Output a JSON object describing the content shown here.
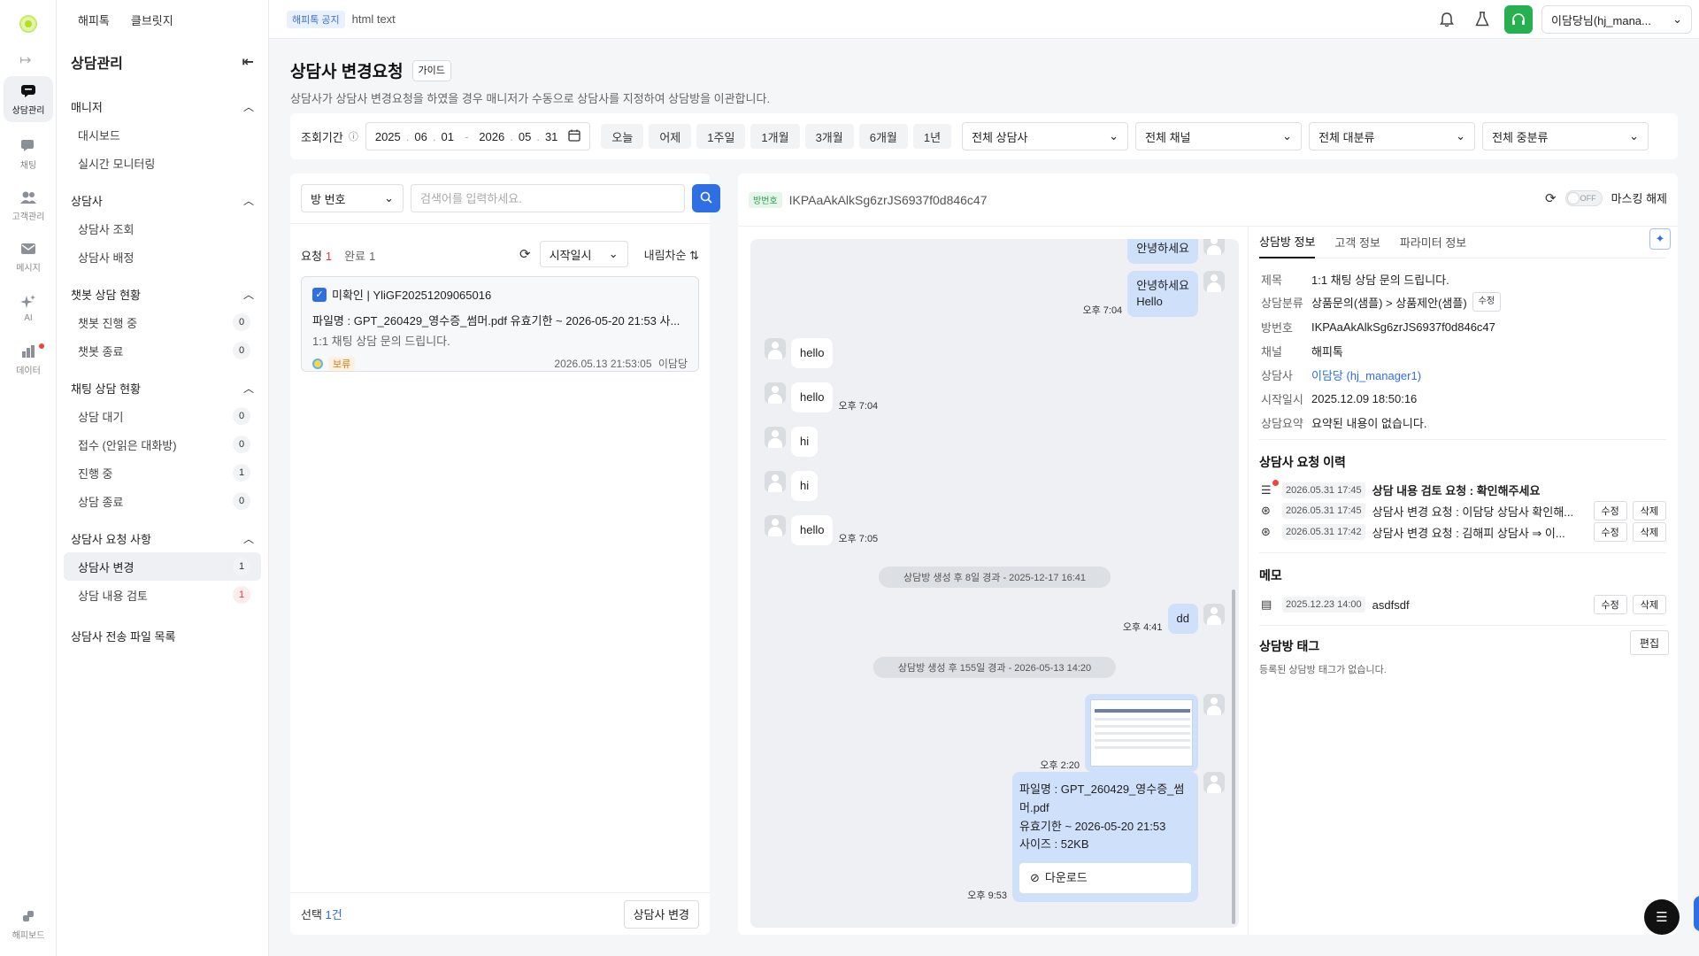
{
  "rail": {
    "items": [
      {
        "label": "상담관리",
        "icon": "chat-bubble-icon"
      },
      {
        "label": "채팅",
        "icon": "message-icon"
      },
      {
        "label": "고객관리",
        "icon": "users-icon"
      },
      {
        "label": "메시지",
        "icon": "mail-icon"
      },
      {
        "label": "AI",
        "icon": "sparkle-icon"
      },
      {
        "label": "데이터",
        "icon": "bar-chart-icon"
      }
    ],
    "bottom_label": "해피보드"
  },
  "sidebar": {
    "top_links": [
      "해피톡",
      "클브릿지"
    ],
    "title": "상담관리",
    "groups": [
      {
        "label": "매니저",
        "items": [
          {
            "label": "대시보드"
          },
          {
            "label": "실시간 모니터링"
          }
        ]
      },
      {
        "label": "상담사",
        "items": [
          {
            "label": "상담사 조회"
          },
          {
            "label": "상담사 배정"
          }
        ]
      },
      {
        "label": "챗봇 상담 현황",
        "items": [
          {
            "label": "챗봇 진행 중",
            "count": "0"
          },
          {
            "label": "챗봇 종료",
            "count": "0"
          }
        ]
      },
      {
        "label": "채팅 상담 현황",
        "items": [
          {
            "label": "상담 대기",
            "count": "0"
          },
          {
            "label": "접수 (안읽은 대화방)",
            "count": "0"
          },
          {
            "label": "진행 중",
            "count": "1"
          },
          {
            "label": "상담 종료",
            "count": "0"
          }
        ]
      },
      {
        "label": "상담사 요청 사항",
        "items": [
          {
            "label": "상담사 변경",
            "count": "1"
          },
          {
            "label": "상담 내용 검토",
            "count": "1"
          }
        ]
      }
    ],
    "plain_item": "상담사 전송 파일 목록"
  },
  "topbar": {
    "notice_tag": "해피톡 공지",
    "notice_text": "html text",
    "user_label": "이담당님(hj_mana..."
  },
  "page": {
    "title": "상담사 변경요청",
    "guide_label": "가이드",
    "description": "상담사가 상담사 변경요청을 하였을 경우 매니저가 수동으로 상담사를 지정하여 상담방을 이관합니다."
  },
  "filters": {
    "period_label": "조회기간",
    "date_from": {
      "y": "2025",
      "m": "06",
      "d": "01"
    },
    "date_to": {
      "y": "2026",
      "m": "05",
      "d": "31"
    },
    "periods": [
      "오늘",
      "어제",
      "1주일",
      "1개월",
      "3개월",
      "6개월",
      "1년"
    ],
    "selects": [
      "전체 상담사",
      "전체 채널",
      "전체 대분류",
      "전체 중분류"
    ]
  },
  "list": {
    "search_type": "방 번호",
    "search_placeholder": "검색어를 입력하세요.",
    "tab_request": "요청",
    "tab_request_count": "1",
    "tab_done": "완료",
    "tab_done_count": "1",
    "sort_field": "시작일시",
    "sort_order": "내림차순",
    "card": {
      "title": "미확인 | YliGF20251209065016",
      "file_line": "파일명 : GPT_260429_영수증_썸머.pdf 유효기한 ~ 2026-05-20 21:53 사...",
      "subject": "1:1 채팅 상담 문의 드립니다.",
      "status": "보류",
      "datetime": "2026.05.13 21:53:05",
      "agent": "이담당"
    },
    "selected_label": "선택",
    "selected_count": "1건",
    "change_button": "상담사 변경"
  },
  "room": {
    "tag": "방번호",
    "id": "IKPAaAkAlkSg6zrJS6937f0d846c47",
    "toggle_label": "OFF",
    "unmask_label": "마스킹 해제"
  },
  "chat": {
    "messages": [
      {
        "text": "안녕하세요"
      },
      {
        "text": "안녕하세요\nHello",
        "time": "오후 7:04"
      },
      {
        "text": "hello"
      },
      {
        "text": "hello",
        "time": "오후 7:04"
      },
      {
        "text": "hi"
      },
      {
        "text": "hi"
      },
      {
        "text": "hello",
        "time": "오후 7:05"
      },
      {
        "text": "dd",
        "time": "오후 4:41"
      },
      {
        "time": "오후 2:20"
      },
      {
        "text": "파일명 : GPT_260429_영수증_썸\n머.pdf\n유효기한 ~ 2026-05-20 21:53\n사이즈 : 52KB",
        "time": "오후 9:53",
        "download": "다운로드"
      }
    ],
    "system": [
      "상담방 생성 후 8일 경과 - 2025-12-17 16:41",
      "상담방 생성 후 155일 경과 - 2026-05-13 14:20"
    ]
  },
  "info": {
    "tabs": [
      "상담방 정보",
      "고객 정보",
      "파라미터 정보"
    ],
    "fields": [
      {
        "k": "제목",
        "v": "1:1 채팅 상담 문의 드립니다."
      },
      {
        "k": "상담분류",
        "v": "상품문의(샘플) > 상품제안(샘플)",
        "edit": "수정"
      },
      {
        "k": "방번호",
        "v": "IKPAaAkAlkSg6zrJS6937f0d846c47"
      },
      {
        "k": "채널",
        "v": "해피톡"
      },
      {
        "k": "상담사",
        "v": "이담당 (hj_manager1)"
      },
      {
        "k": "시작일시",
        "v": "2025.12.09 18:50:16"
      },
      {
        "k": "상담요약",
        "v": "요약된 내용이 없습니다."
      }
    ],
    "history_title": "상담사 요청 이력",
    "history": [
      {
        "date": "2026.05.31 17:45",
        "text": "상담 내용 검토 요청 : 확인해주세요"
      },
      {
        "date": "2026.05.31 17:45",
        "text": "상담사 변경 요청 : 이담당 상담사 확인해...",
        "edit": "수정",
        "del": "삭제"
      },
      {
        "date": "2026.05.31 17:42",
        "text": "상담사 변경 요청 : 김해피 상담사 ⇒ 이...",
        "edit": "수정",
        "del": "삭제"
      }
    ],
    "memo_title": "메모",
    "memo": {
      "date": "2025.12.23 14:00",
      "text": "asdfsdf",
      "edit": "수정",
      "del": "삭제"
    },
    "tag_title": "상담방 태그",
    "tag_edit": "편집",
    "tag_empty": "등록된 상담방 태그가 없습니다."
  },
  "colors": {
    "primary": "#2f6fe4",
    "green": "#27b04f",
    "red": "#e0393e",
    "bubble_me": "#cfe0fb"
  }
}
